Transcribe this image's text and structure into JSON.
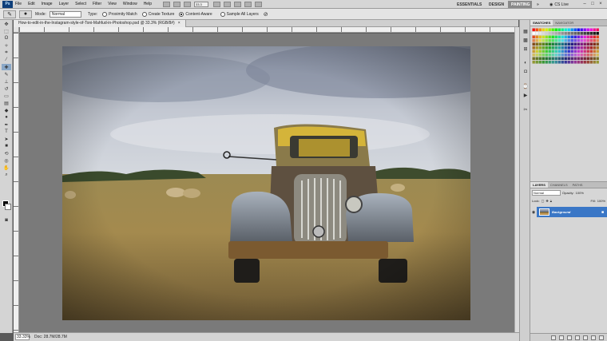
{
  "menubar": {
    "app_logo": "Ps",
    "items": [
      "File",
      "Edit",
      "Image",
      "Layer",
      "Select",
      "Filter",
      "View",
      "Window",
      "Help"
    ],
    "zoom_value": "33.3",
    "workspaces": {
      "essentials": "ESSENTIALS",
      "design": "DESIGN",
      "painting": "PAINTING",
      "more": "»"
    },
    "cs_live": "CS Live",
    "window_controls": {
      "minimize": "–",
      "restore": "□",
      "close": "×"
    }
  },
  "options_bar": {
    "mode_label": "Mode:",
    "mode_value": "Normal",
    "type_label": "Type:",
    "types": [
      {
        "label": "Proximity Match",
        "selected": false
      },
      {
        "label": "Create Texture",
        "selected": false
      },
      {
        "label": "Content-Aware",
        "selected": true
      }
    ],
    "sample_all_layers": "Sample All Layers"
  },
  "document": {
    "tab_title": "How-to-edit-in-the-Instagram-style-of-Toni-Mahfud-in-Photoshop.psd @ 33.3% (RGB/8#)",
    "close": "×"
  },
  "status": {
    "zoom": "33.33%",
    "doc_size": "Doc: 28.7M/28.7M"
  },
  "panels": {
    "swatches_tab": "SWATCHES",
    "navigator_tab": "NAVIGATOR",
    "layers_tab": "LAYERS",
    "channels_tab": "CHANNELS",
    "paths_tab": "PATHS",
    "blend_mode": "Normal",
    "opacity_label": "Opacity:",
    "opacity": "100%",
    "lock_label": "Lock:",
    "fill_label": "Fill:",
    "fill": "100%",
    "layer_name": "Background"
  }
}
